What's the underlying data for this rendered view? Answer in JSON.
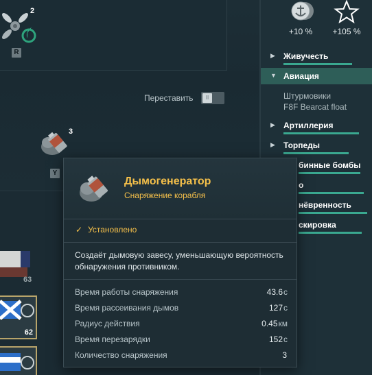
{
  "slots": {
    "plane_count": "2",
    "plane_key": "R",
    "smoke_count": "3",
    "smoke_key": "Y",
    "flag1_count": "63",
    "flag2_count": "62"
  },
  "swap_label": "Переставить",
  "bonuses": [
    {
      "icon": "anchor-medal-icon",
      "value": "+10 %"
    },
    {
      "icon": "star-icon",
      "value": "+105 %"
    }
  ],
  "categories": [
    {
      "label": "Живучесть",
      "expanded": false
    },
    {
      "label": "Авиация",
      "expanded": true
    },
    {
      "label": "Артиллерия",
      "expanded": false
    },
    {
      "label": "Торпеды",
      "expanded": false
    },
    {
      "label": "бинные бомбы",
      "expanded": false
    },
    {
      "label": "о",
      "expanded": false
    },
    {
      "label": "нёвренность",
      "expanded": false
    },
    {
      "label": "скировка",
      "expanded": false
    }
  ],
  "aviation_items": [
    "Штурмовики",
    "F8F Bearcat float"
  ],
  "tooltip": {
    "title": "Дымогенератор",
    "subtitle": "Снаряжение корабля",
    "status": "Установлено",
    "description": "Создаёт дымовую завесу, уменьшающую вероятность обнаружения противником.",
    "stats": [
      {
        "name": "Время работы снаряжения",
        "value": "43.6",
        "unit": "с"
      },
      {
        "name": "Время рассеивания дымов",
        "value": "127",
        "unit": "с"
      },
      {
        "name": "Радиус действия",
        "value": "0.45",
        "unit": "км"
      },
      {
        "name": "Время перезарядки",
        "value": "152",
        "unit": "с"
      },
      {
        "name": "Количество снаряжения",
        "value": "3",
        "unit": ""
      }
    ]
  },
  "colors": {
    "accent_gold": "#f5c04a",
    "accent_teal": "#3aa890",
    "background": "#16262d"
  }
}
